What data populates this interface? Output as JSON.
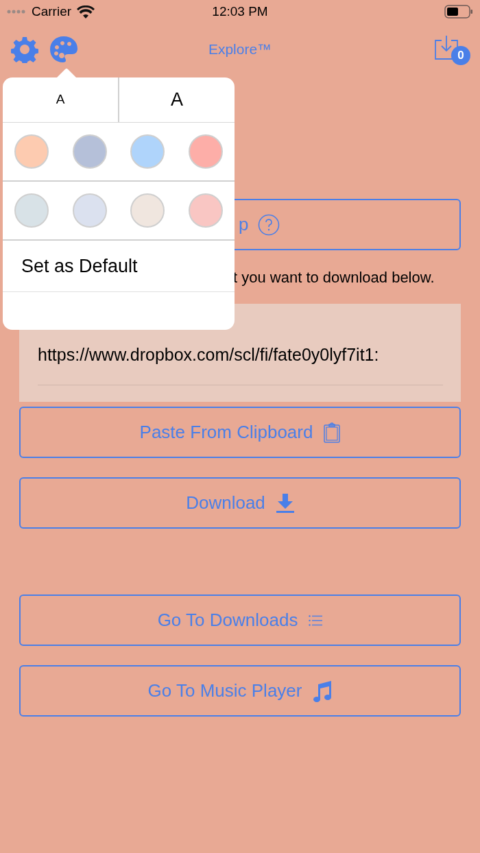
{
  "status_bar": {
    "carrier": "Carrier",
    "time": "12:03 PM"
  },
  "nav_bar": {
    "title": "Explore™",
    "downloads_badge": "0"
  },
  "help_button": {
    "label": "p"
  },
  "instruction": "t you want to download below.",
  "url_field": {
    "value": "https://www.dropbox.com/scl/fi/fate0y0lyf7it1:"
  },
  "buttons": [
    {
      "label": "Paste From Clipboard",
      "kind": "clipboard"
    },
    {
      "label": "Download",
      "kind": "download"
    },
    {
      "label": "Go To Downloads",
      "kind": "list"
    },
    {
      "label": "Go To Music Player",
      "kind": "music"
    }
  ],
  "popover": {
    "font_sizes": [
      {
        "label": "A",
        "kind": "small"
      },
      {
        "label": "A",
        "kind": "large"
      }
    ],
    "themes": [
      {
        "color": "#fdcbb0"
      },
      {
        "color": "#b5c0d9"
      },
      {
        "color": "#afd4fb"
      },
      {
        "color": "#fdaea8"
      },
      {
        "color": "#d8e2e7"
      },
      {
        "color": "#dbe1ef"
      },
      {
        "color": "#f0e6df"
      },
      {
        "color": "#f9c6c3"
      }
    ],
    "set_default": "Set as Default"
  }
}
